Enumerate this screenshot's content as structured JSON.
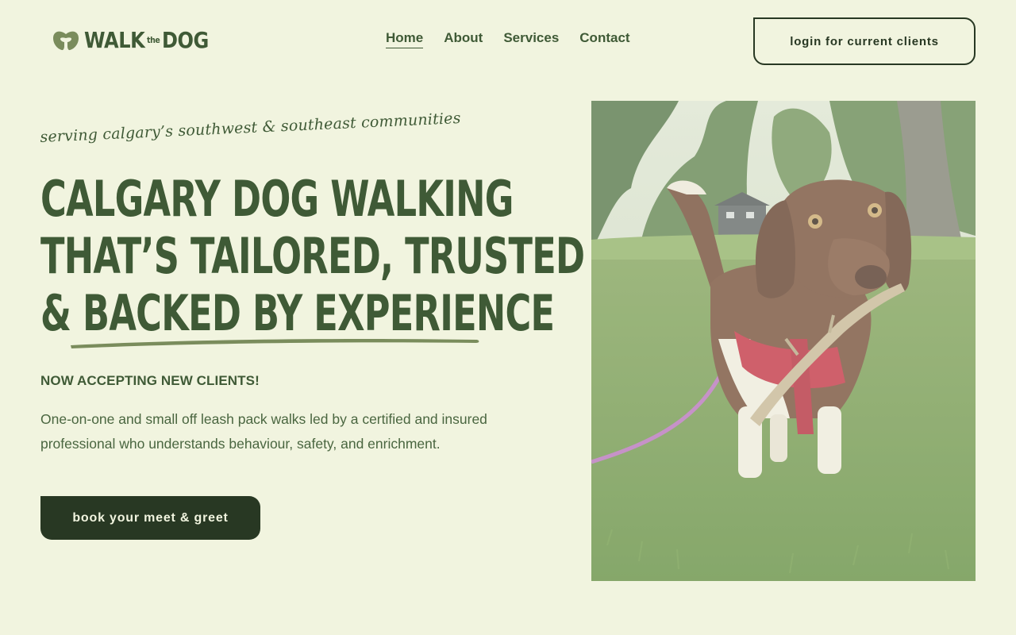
{
  "brand": {
    "name_left": "WALK",
    "name_mid": "the",
    "name_right": "DOG"
  },
  "nav": {
    "items": [
      {
        "label": "Home",
        "active": true
      },
      {
        "label": "About"
      },
      {
        "label": "Services"
      },
      {
        "label": "Contact"
      }
    ]
  },
  "header": {
    "login_label": "login for current clients"
  },
  "hero": {
    "tagline": "serving calgary’s southwest & southeast communities",
    "headline_lines": [
      "CALGARY DOG WALKING",
      "THAT’S TAILORED, TRUSTED",
      "& BACKED BY EXPERIENCE"
    ],
    "accepting": "NOW ACCEPTING NEW CLIENTS!",
    "description": "One-on-one and small off leash pack walks led by a certified and insured professional who understands behaviour, safety, and enrichment.",
    "cta_label": "book your meet & greet"
  },
  "colors": {
    "background": "#f1f4df",
    "primary_green": "#3f5a36",
    "dark_green": "#283823",
    "accent_green": "#7a8c5c"
  },
  "icons": {
    "logo": "dog-nose-icon"
  }
}
